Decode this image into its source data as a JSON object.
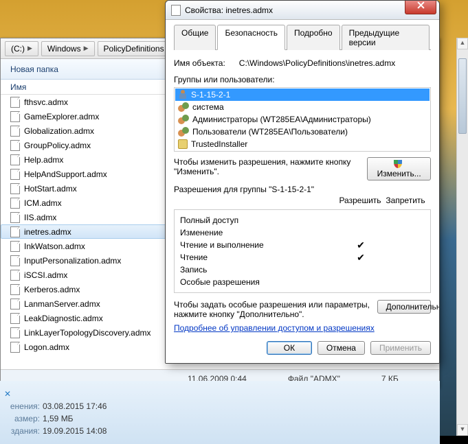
{
  "explorer": {
    "breadcrumb": [
      "(C:)",
      "Windows",
      "PolicyDefinitions"
    ],
    "toolbar_new_folder": "Новая папка",
    "col_name": "Имя",
    "files": [
      "fthsvc.admx",
      "GameExplorer.admx",
      "Globalization.admx",
      "GroupPolicy.admx",
      "Help.admx",
      "HelpAndSupport.admx",
      "HotStart.admx",
      "ICM.admx",
      "IIS.admx",
      "inetres.admx",
      "InkWatson.admx",
      "InputPersonalization.admx",
      "iSCSI.admx",
      "Kerberos.admx",
      "LanmanServer.admx",
      "LeakDiagnostic.admx",
      "LinkLayerTopologyDiscovery.admx",
      "Logon.admx"
    ],
    "selected_index": 9,
    "status_date": "11.06.2009 0:44",
    "status_type": "Файл \"ADMX\"",
    "status_size": "7 КБ"
  },
  "info": {
    "changed_label": "енения:",
    "changed_val": "03.08.2015 17:46",
    "size_label": "азмер:",
    "size_val": "1,59 МБ",
    "created_label": "здания:",
    "created_val": "19.09.2015 14:08"
  },
  "dialog": {
    "title": "Свойства: inetres.admx",
    "tabs": {
      "general": "Общие",
      "security": "Безопасность",
      "details": "Подробно",
      "prev": "Предыдущие версии"
    },
    "object_label": "Имя объекта:",
    "object_path": "C:\\Windows\\PolicyDefinitions\\inetres.admx",
    "groups_label": "Группы или пользователи:",
    "groups": [
      "S-1-15-2-1",
      "система",
      "Администраторы (WT285EA\\Администраторы)",
      "Пользователи (WT285EA\\Пользователи)",
      "TrustedInstaller"
    ],
    "edit_hint": "Чтобы изменить разрешения, нажмите кнопку \"Изменить\".",
    "edit_btn": "Изменить...",
    "perm_for": "Разрешения для группы \"S-1-15-2-1\"",
    "col_allow": "Разрешить",
    "col_deny": "Запретить",
    "perms": [
      {
        "name": "Полный доступ",
        "allow": false,
        "deny": false
      },
      {
        "name": "Изменение",
        "allow": false,
        "deny": false
      },
      {
        "name": "Чтение и выполнение",
        "allow": true,
        "deny": false
      },
      {
        "name": "Чтение",
        "allow": true,
        "deny": false
      },
      {
        "name": "Запись",
        "allow": false,
        "deny": false
      },
      {
        "name": "Особые разрешения",
        "allow": false,
        "deny": false
      }
    ],
    "adv_hint": "Чтобы задать особые разрешения или параметры, нажмите кнопку \"Дополнительно\".",
    "adv_btn": "Дополнительно",
    "link_more": "Подробнее об управлении доступом и разрешениях",
    "ok": "ОК",
    "cancel": "Отмена",
    "apply": "Применить"
  }
}
